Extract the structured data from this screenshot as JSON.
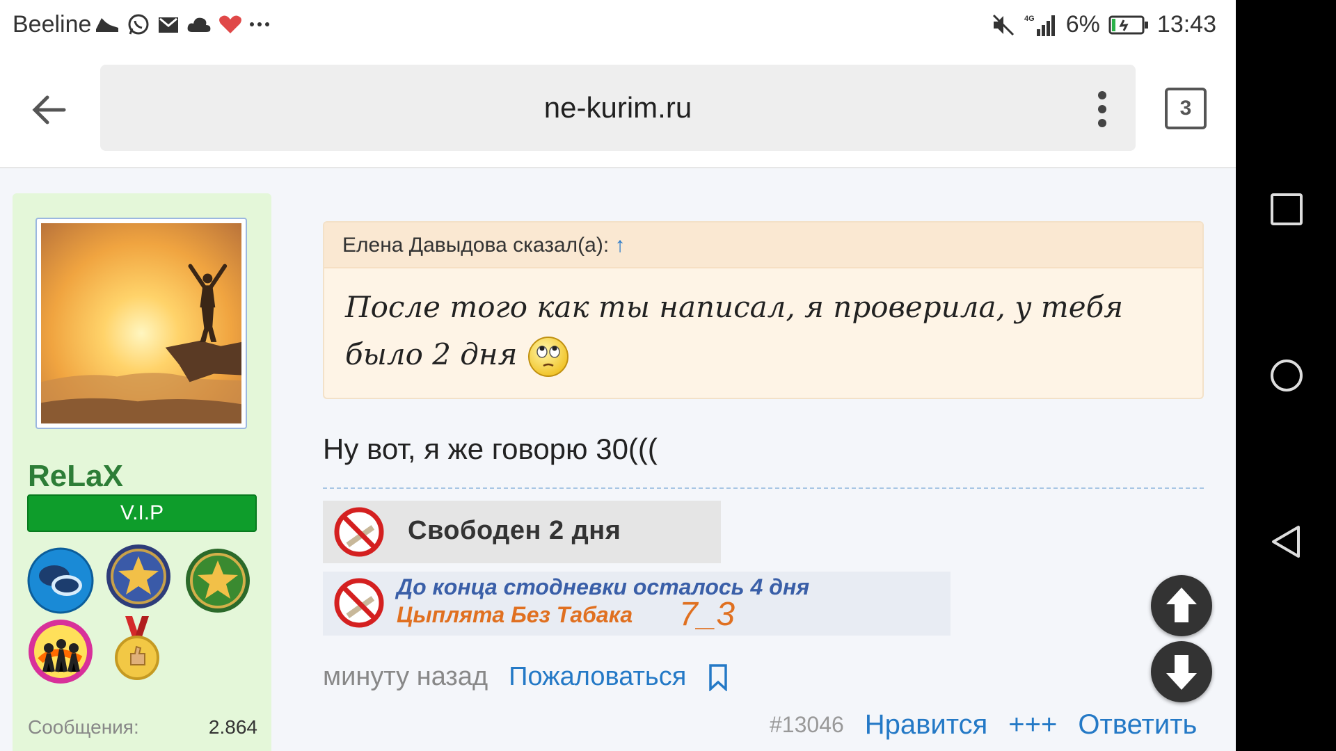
{
  "status_bar": {
    "carrier": "Beeline",
    "notification_icons": [
      "shoe-icon",
      "whatsapp-icon",
      "mail-icon",
      "cloud-icon",
      "heart-icon",
      "more-icon"
    ],
    "network": "4G",
    "battery": "6%",
    "time": "13:43"
  },
  "browser": {
    "url": "ne-kurim.ru",
    "tab_count": "3"
  },
  "user": {
    "name": "ReLaX",
    "rank": "V.I.P",
    "stats_label": "Сообщения:",
    "stats_value": "2.864",
    "awards": [
      "chat-award-icon",
      "star-blue-award-icon",
      "star-green-award-icon",
      "group-award-icon",
      "medal-award-icon"
    ]
  },
  "post": {
    "quote_author": "Елена Давыдова сказал(а):",
    "quote_arrow": "↑",
    "quote_text": "После того как ты написал, я проверила, у тебя было 2 дня",
    "message": "Ну вот, я же говорю 30(((",
    "signature1": "Свободен 2 дня",
    "signature2_line1": "До конца стодневки осталось 4 дня",
    "signature2_line2": "Цыплята Без Табака",
    "signature2_number": "7_3",
    "time": "минуту назад",
    "report": "Пожаловаться",
    "post_id": "#13046",
    "like": "Нравится",
    "plus": "+++",
    "reply": "Ответить"
  },
  "colors": {
    "sidebar_bg": "#e4f7d9",
    "username": "#2d7d37",
    "rank_bg": "#0e9d2b",
    "link": "#2479c6",
    "quote_bg": "#fef4e6"
  }
}
